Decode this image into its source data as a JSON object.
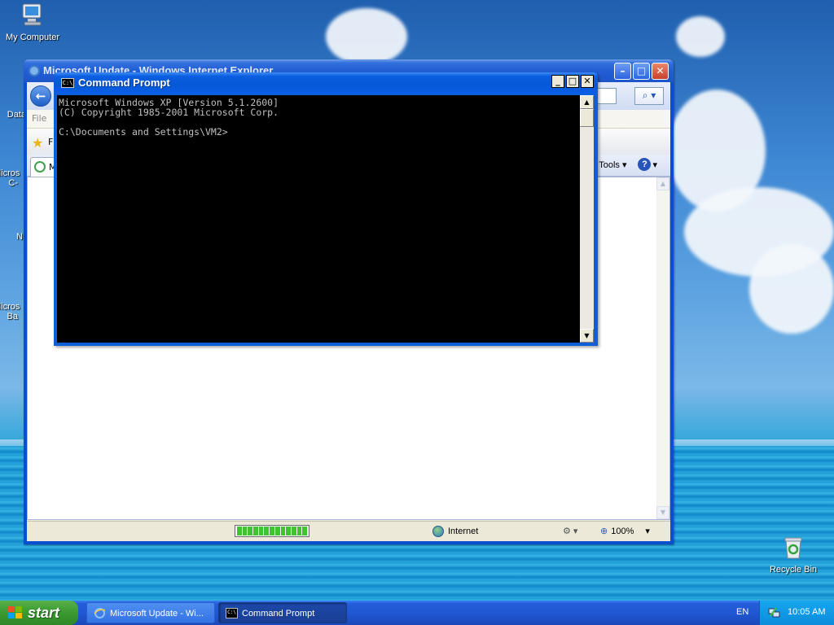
{
  "desktop": {
    "icons": [
      {
        "label": "My Computer"
      },
      {
        "label": "Data"
      },
      {
        "label": "Micros C-"
      },
      {
        "label": "N"
      },
      {
        "label": "Micros Ba"
      },
      {
        "label": "Recycle Bin"
      }
    ]
  },
  "ie_window": {
    "title": "Microsoft Update - Windows Internet Explorer",
    "menu_file": "File",
    "fav_label": "F",
    "tab_label": "M",
    "tools_label": "Tools",
    "status_zone": "Internet",
    "zoom": "100%",
    "progress_segments": 13,
    "progress_fraction": 1.0
  },
  "cmd_window": {
    "title": "Command Prompt",
    "icon_text": "C:\\",
    "lines": [
      "Microsoft Windows XP [Version 5.1.2600]",
      "(C) Copyright 1985-2001 Microsoft Corp.",
      "",
      "C:\\Documents and Settings\\VM2>"
    ]
  },
  "taskbar": {
    "start_label": "start",
    "tasks": [
      {
        "label": "Microsoft Update - Wi..."
      },
      {
        "label": "Command Prompt"
      }
    ],
    "language": "EN",
    "clock": "10:05 AM"
  },
  "colors": {
    "xp_title_blue": "#0558d6",
    "start_green": "#3a9a30",
    "console_bg": "#000000",
    "console_text": "#c0c0c0"
  }
}
